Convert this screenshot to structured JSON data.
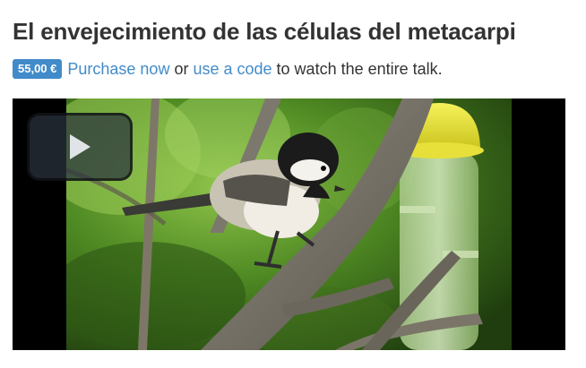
{
  "talk": {
    "title": "El envejecimiento de las células del metacarpi"
  },
  "purchase": {
    "price": "55,00 €",
    "purchase_link": "Purchase now",
    "or_text": "or",
    "code_link": "use a code",
    "suffix": "to watch the entire talk."
  },
  "player": {
    "play_icon": "play-icon"
  },
  "colors": {
    "accent": "#428bca",
    "text": "#333333"
  }
}
